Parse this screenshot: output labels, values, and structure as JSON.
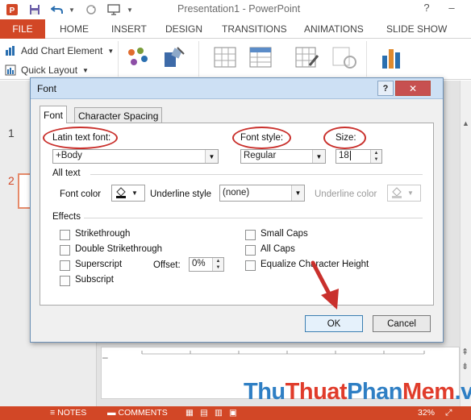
{
  "app": {
    "title": "Presentation1 - PowerPoint",
    "help_glyph": "?",
    "minimize_glyph": "–"
  },
  "ribbon_tabs": [
    "FILE",
    "HOME",
    "INSERT",
    "DESIGN",
    "TRANSITIONS",
    "ANIMATIONS",
    "SLIDE SHOW"
  ],
  "ribbon": {
    "add_chart_element": "Add Chart Element",
    "quick_layout": "Quick Layout"
  },
  "thumbnails": {
    "slide_1": "1",
    "slide_2": "2"
  },
  "status": {
    "notes": "NOTES",
    "comments": "COMMENTS",
    "zoom": "32%"
  },
  "watermark": {
    "part1": "Thu",
    "part2": "Thuat",
    "part3": "Phan",
    "part4": "Mem",
    "part5": ".vn"
  },
  "dialog": {
    "title": "Font",
    "help": "?",
    "close": "✕",
    "tabs": {
      "font": "Font",
      "spacing": "Character Spacing"
    },
    "latin_text_font": {
      "label": "Latin text font:",
      "value": "+Body"
    },
    "font_style": {
      "label": "Font style:",
      "value": "Regular"
    },
    "size": {
      "label": "Size:",
      "value": "18"
    },
    "all_text": {
      "group": "All text",
      "font_color_label": "Font color",
      "underline_style_label": "Underline style",
      "underline_style_value": "(none)",
      "underline_color_label": "Underline color"
    },
    "effects": {
      "group": "Effects",
      "strikethrough": "Strikethrough",
      "double_strikethrough": "Double Strikethrough",
      "superscript": "Superscript",
      "subscript": "Subscript",
      "offset_label": "Offset:",
      "offset_value": "0%",
      "small_caps": "Small Caps",
      "all_caps": "All Caps",
      "equalize": "Equalize Character Height"
    },
    "ok": "OK",
    "cancel": "Cancel"
  },
  "colors": {
    "accent": "#d24726",
    "annotation_red": "#c9302c",
    "arrow_red": "#c9302c"
  }
}
